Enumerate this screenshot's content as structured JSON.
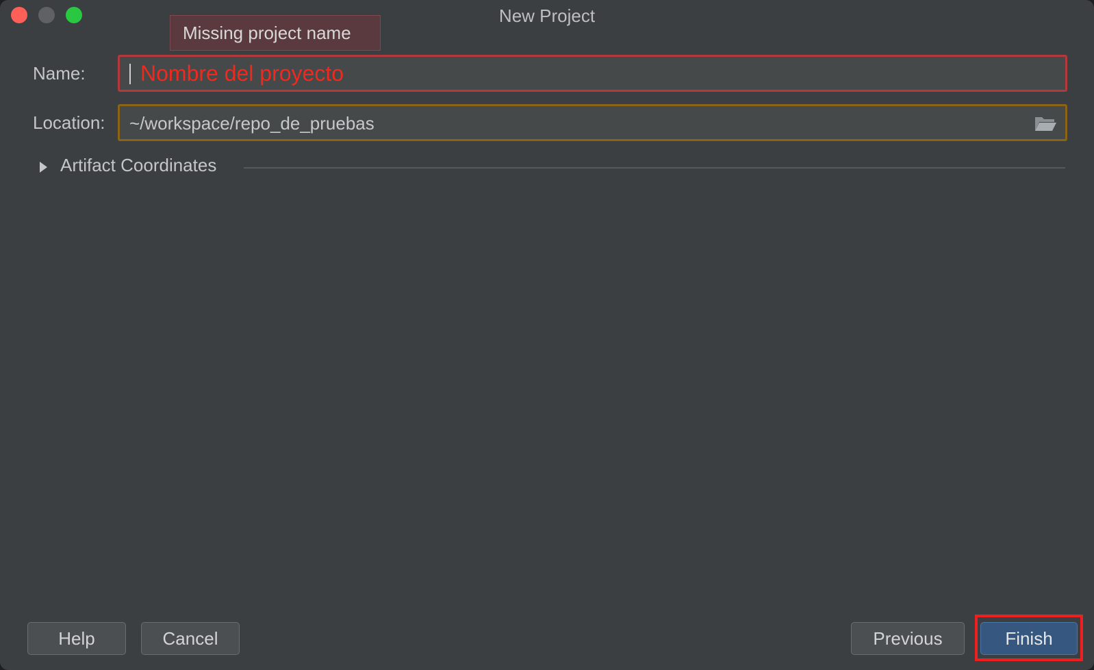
{
  "window": {
    "title": "New Project"
  },
  "tooltip": {
    "text": "Missing project name"
  },
  "form": {
    "name_label": "Name:",
    "name_placeholder": "Nombre del proyecto",
    "location_label": "Location:",
    "location_value": "~/workspace/repo_de_pruebas"
  },
  "disclosure": {
    "label": "Artifact Coordinates"
  },
  "buttons": {
    "help": "Help",
    "cancel": "Cancel",
    "previous": "Previous",
    "finish": "Finish"
  },
  "icons": {
    "folder": "folder-open-icon",
    "disclosure": "triangle-right-icon"
  },
  "colors": {
    "error": "#f0291f",
    "error_border": "#b3393d",
    "warning_border": "#8b6418",
    "primary_button": "#365880",
    "highlight": "#ee1f1f"
  }
}
